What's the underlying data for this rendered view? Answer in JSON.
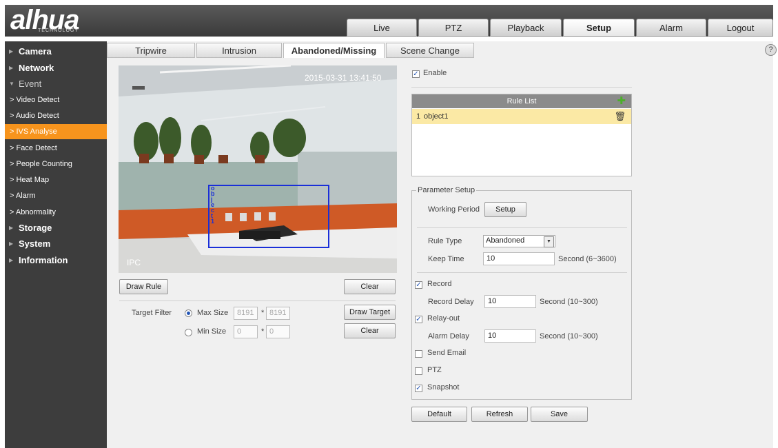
{
  "header": {
    "logo": "alhua",
    "logo_sub": "TECHNOLOGY",
    "nav": [
      "Live",
      "PTZ",
      "Playback",
      "Setup",
      "Alarm",
      "Logout"
    ],
    "nav_active": "Setup"
  },
  "sidebar": {
    "items": [
      {
        "label": "Camera",
        "type": "main"
      },
      {
        "label": "Network",
        "type": "main"
      },
      {
        "label": "Event",
        "type": "main-open"
      },
      {
        "label": "> Video Detect",
        "type": "sub"
      },
      {
        "label": "> Audio Detect",
        "type": "sub"
      },
      {
        "label": "> IVS Analyse",
        "type": "sub",
        "active": true
      },
      {
        "label": "> Face Detect",
        "type": "sub"
      },
      {
        "label": "> People Counting",
        "type": "sub"
      },
      {
        "label": "> Heat Map",
        "type": "sub"
      },
      {
        "label": "> Alarm",
        "type": "sub"
      },
      {
        "label": "> Abnormality",
        "type": "sub"
      },
      {
        "label": "Storage",
        "type": "main"
      },
      {
        "label": "System",
        "type": "main"
      },
      {
        "label": "Information",
        "type": "main"
      }
    ]
  },
  "subtabs": [
    "Tripwire",
    "Intrusion",
    "Abandoned/Missing",
    "Scene Change"
  ],
  "help_icon": "?",
  "video": {
    "timestamp": "2015-03-31 13:41:50",
    "channel_label": "IPC",
    "rule_name_vertical": "object1"
  },
  "video_controls": {
    "draw_rule": "Draw Rule",
    "clear_top": "Clear",
    "target_filter_label": "Target Filter",
    "max_size_label": "Max Size",
    "max_w": "8191",
    "max_h": "8191",
    "min_size_label": "Min Size",
    "min_w": "0",
    "min_h": "0",
    "times": "*",
    "draw_target": "Draw Target",
    "clear_bottom": "Clear"
  },
  "enable": {
    "label": "Enable",
    "checked": true
  },
  "rule_list": {
    "header": "Rule List",
    "rows": [
      {
        "index": "1",
        "name": "object1"
      }
    ]
  },
  "params": {
    "legend": "Parameter Setup",
    "working_period_label": "Working Period",
    "setup_button": "Setup",
    "rule_type_label": "Rule Type",
    "rule_type_value": "Abandoned",
    "keep_time_label": "Keep Time",
    "keep_time_value": "10",
    "keep_time_range": "Second (6~3600)",
    "record_label": "Record",
    "record_checked": true,
    "record_delay_label": "Record Delay",
    "record_delay_value": "10",
    "record_delay_range": "Second (10~300)",
    "relay_label": "Relay-out",
    "relay_checked": true,
    "alarm_delay_label": "Alarm Delay",
    "alarm_delay_value": "10",
    "alarm_delay_range": "Second (10~300)",
    "send_email_label": "Send Email",
    "send_email_checked": false,
    "ptz_label": "PTZ",
    "ptz_checked": false,
    "snapshot_label": "Snapshot",
    "snapshot_checked": true
  },
  "footer": {
    "default": "Default",
    "refresh": "Refresh",
    "save": "Save"
  },
  "colors": {
    "accent": "#f7941d",
    "rule_selected": "#fbe9a5",
    "rule_header": "#8b8b8b",
    "sidebar_bg": "#3d3d3d",
    "roi_box": "#1a2fd8"
  }
}
